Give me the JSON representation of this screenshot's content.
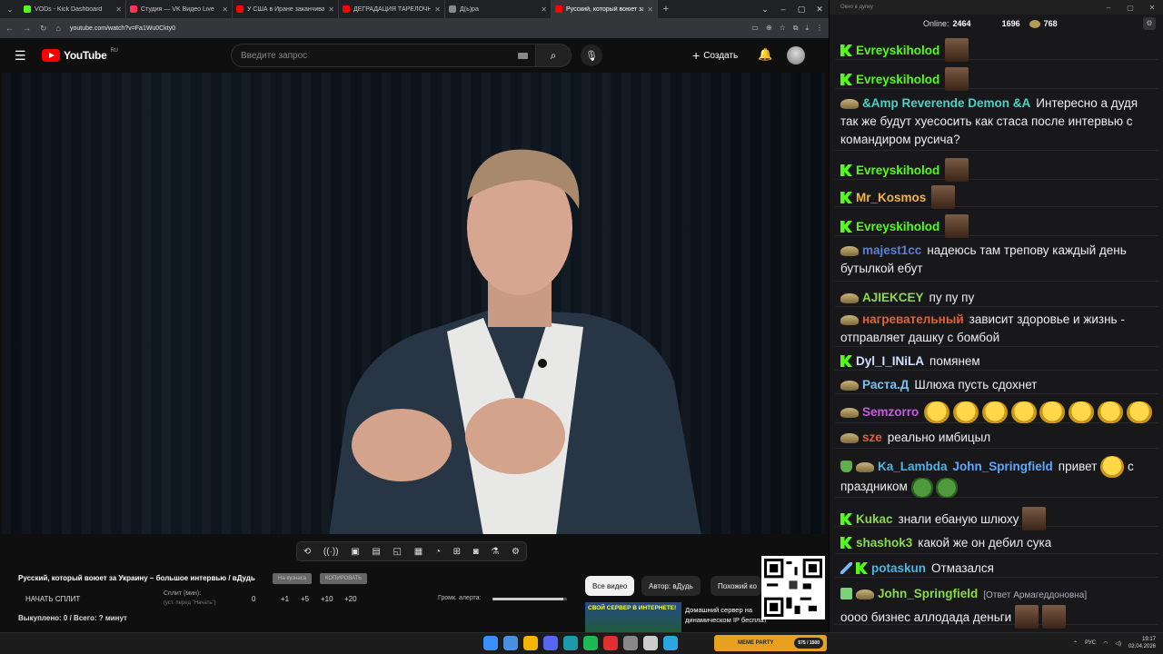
{
  "browser": {
    "tabs": [
      {
        "title": "VODs - Kick Dashboard",
        "color": "#53fc18"
      },
      {
        "title": "Студия — VK Видео Live",
        "color": "#ff3355"
      },
      {
        "title": "У США в Иране заканчиваются",
        "color": "#ff0000"
      },
      {
        "title": "ДЕГРАДАЦИЯ ТАРЕЛОЧНИЦ",
        "color": "#ff0000"
      },
      {
        "title": "Д(ь)ра",
        "color": "#888888"
      },
      {
        "title": "Русский, который воюет за",
        "color": "#ff0000"
      }
    ],
    "url": "youtube.com/watch?v=Fa1Wu0Ckty0"
  },
  "youtube": {
    "region": "RU",
    "logo_text": "YouTube",
    "search_placeholder": "Введите запрос",
    "create_label": "Создать"
  },
  "panel": {
    "video_title": "Русский, который воюет за Украину – большое интервью / вДудь",
    "pill1": "На вузнаса",
    "pill2": "КОПИРОВАТЬ",
    "split_button": "НАЧАТЬ СПЛИТ",
    "split_min_label": "Сплит (мин):",
    "split_min_sub": "(уст. перед \"Начать\")",
    "steps": [
      "0",
      "+1",
      "+5",
      "+10",
      "+20"
    ],
    "alert_label": "Громк. алерта:",
    "alert_volume": 0.95,
    "bought": "Выкуплено: 0 / Всего: ? минут"
  },
  "filters": {
    "all": "Все видео",
    "author": "Автор: вДудь",
    "similar": "Похожий ко"
  },
  "recommendation": {
    "thumb_text": "СВОЙ СЕРВЕР В ИНТЕРНЕТЕ!",
    "title_line1": "Домашний сервер на",
    "title_line2": "динамическом IP бесплатно!..."
  },
  "chat": {
    "window_title": "Окно в дупку",
    "online_label": "Online:",
    "online": "2464",
    "count1": "1696",
    "count2": "768",
    "messages": [
      {
        "badge": "k",
        "user": "Evreyskiholod",
        "color": "#53fc18",
        "text": "",
        "emotes": [
          "face"
        ]
      },
      {
        "badge": "k",
        "user": "Evreyskiholod",
        "color": "#53fc18",
        "text": "",
        "emotes": [
          "face"
        ]
      },
      {
        "badge": "bird",
        "user": "&Amp Reverende Demon &A",
        "color": "#4fd0c4",
        "text": "Интересно а дудя так же будут хуесосить как стаса после интервью с командиром русича?",
        "emotes": []
      },
      {
        "badge": "k",
        "user": "Evreyskiholod",
        "color": "#53fc18",
        "text": "",
        "emotes": [
          "face"
        ]
      },
      {
        "badge": "k",
        "user": "Mr_Kosmos",
        "color": "#f5b342",
        "text": "",
        "emotes": [
          "face"
        ]
      },
      {
        "badge": "k",
        "user": "Evreyskiholod",
        "color": "#53fc18",
        "text": "",
        "emotes": [
          "face"
        ]
      },
      {
        "badge": "bird",
        "user": "majest1cc",
        "color": "#5a7fd6",
        "text": "надеюсь там трепову каждый день бутылкой ебут",
        "emotes": []
      },
      {
        "badge": "bird",
        "user": "AJIEKCEY",
        "color": "#8bd94a",
        "text": "пу пу пу",
        "emotes": []
      },
      {
        "badge": "bird",
        "user": "нагревательный",
        "color": "#e0613a",
        "text": "зависит здоровье и жизнь - отправляет дашку с бомбой",
        "emotes": []
      },
      {
        "badge": "k",
        "user": "Dyl_I_INiLA",
        "color": "#cfe0ff",
        "text": "помянем",
        "emotes": []
      },
      {
        "badge": "bird",
        "user": "Раста.Д",
        "color": "#7ac0f0",
        "text": "Шлюха пусть сдохнет",
        "emotes": []
      },
      {
        "badge": "bird",
        "user": "Semzorro",
        "color": "#c85ae0",
        "text": "",
        "emotes": [
          "laugh",
          "laugh",
          "laugh",
          "laugh",
          "laugh",
          "laugh",
          "laugh",
          "laugh"
        ]
      },
      {
        "badge": "bird",
        "user": "sze",
        "color": "#e0613a",
        "text": "реально имбицыл",
        "emotes": []
      },
      {
        "badge": "shield",
        "user": "Ka_Lambda",
        "color": "#4fb4e0",
        "mention": "John_Springfield",
        "text": "привет",
        "text2": "с праздником",
        "emotes": [
          "pepe",
          "pepe"
        ]
      },
      {
        "badge": "k",
        "user": "Kukac",
        "color": "#8bd94a",
        "text": "знали ебаную шлюху",
        "emotes": [
          "face"
        ]
      },
      {
        "badge": "k",
        "user": "shashok3",
        "color": "#8bd94a",
        "text": "какой же он дебил сука",
        "emotes": []
      },
      {
        "badge": "sword",
        "user": "potaskun",
        "color": "#4fb4e0",
        "text": "Отмазался",
        "emotes": []
      },
      {
        "badge": "pencil",
        "user": "John_Springfield",
        "color": "#8bd94a",
        "reply": "[Ответ Армагеддоновна]",
        "text": "оооо бизнес аллодада деньги",
        "emotes": [
          "face",
          "face"
        ]
      }
    ]
  },
  "taskbar": {
    "ad_text": "MEME PARTY",
    "ad_counter": "575 / 1500",
    "lang": "РУС",
    "time": "19:17",
    "date": "02.04.2026"
  }
}
